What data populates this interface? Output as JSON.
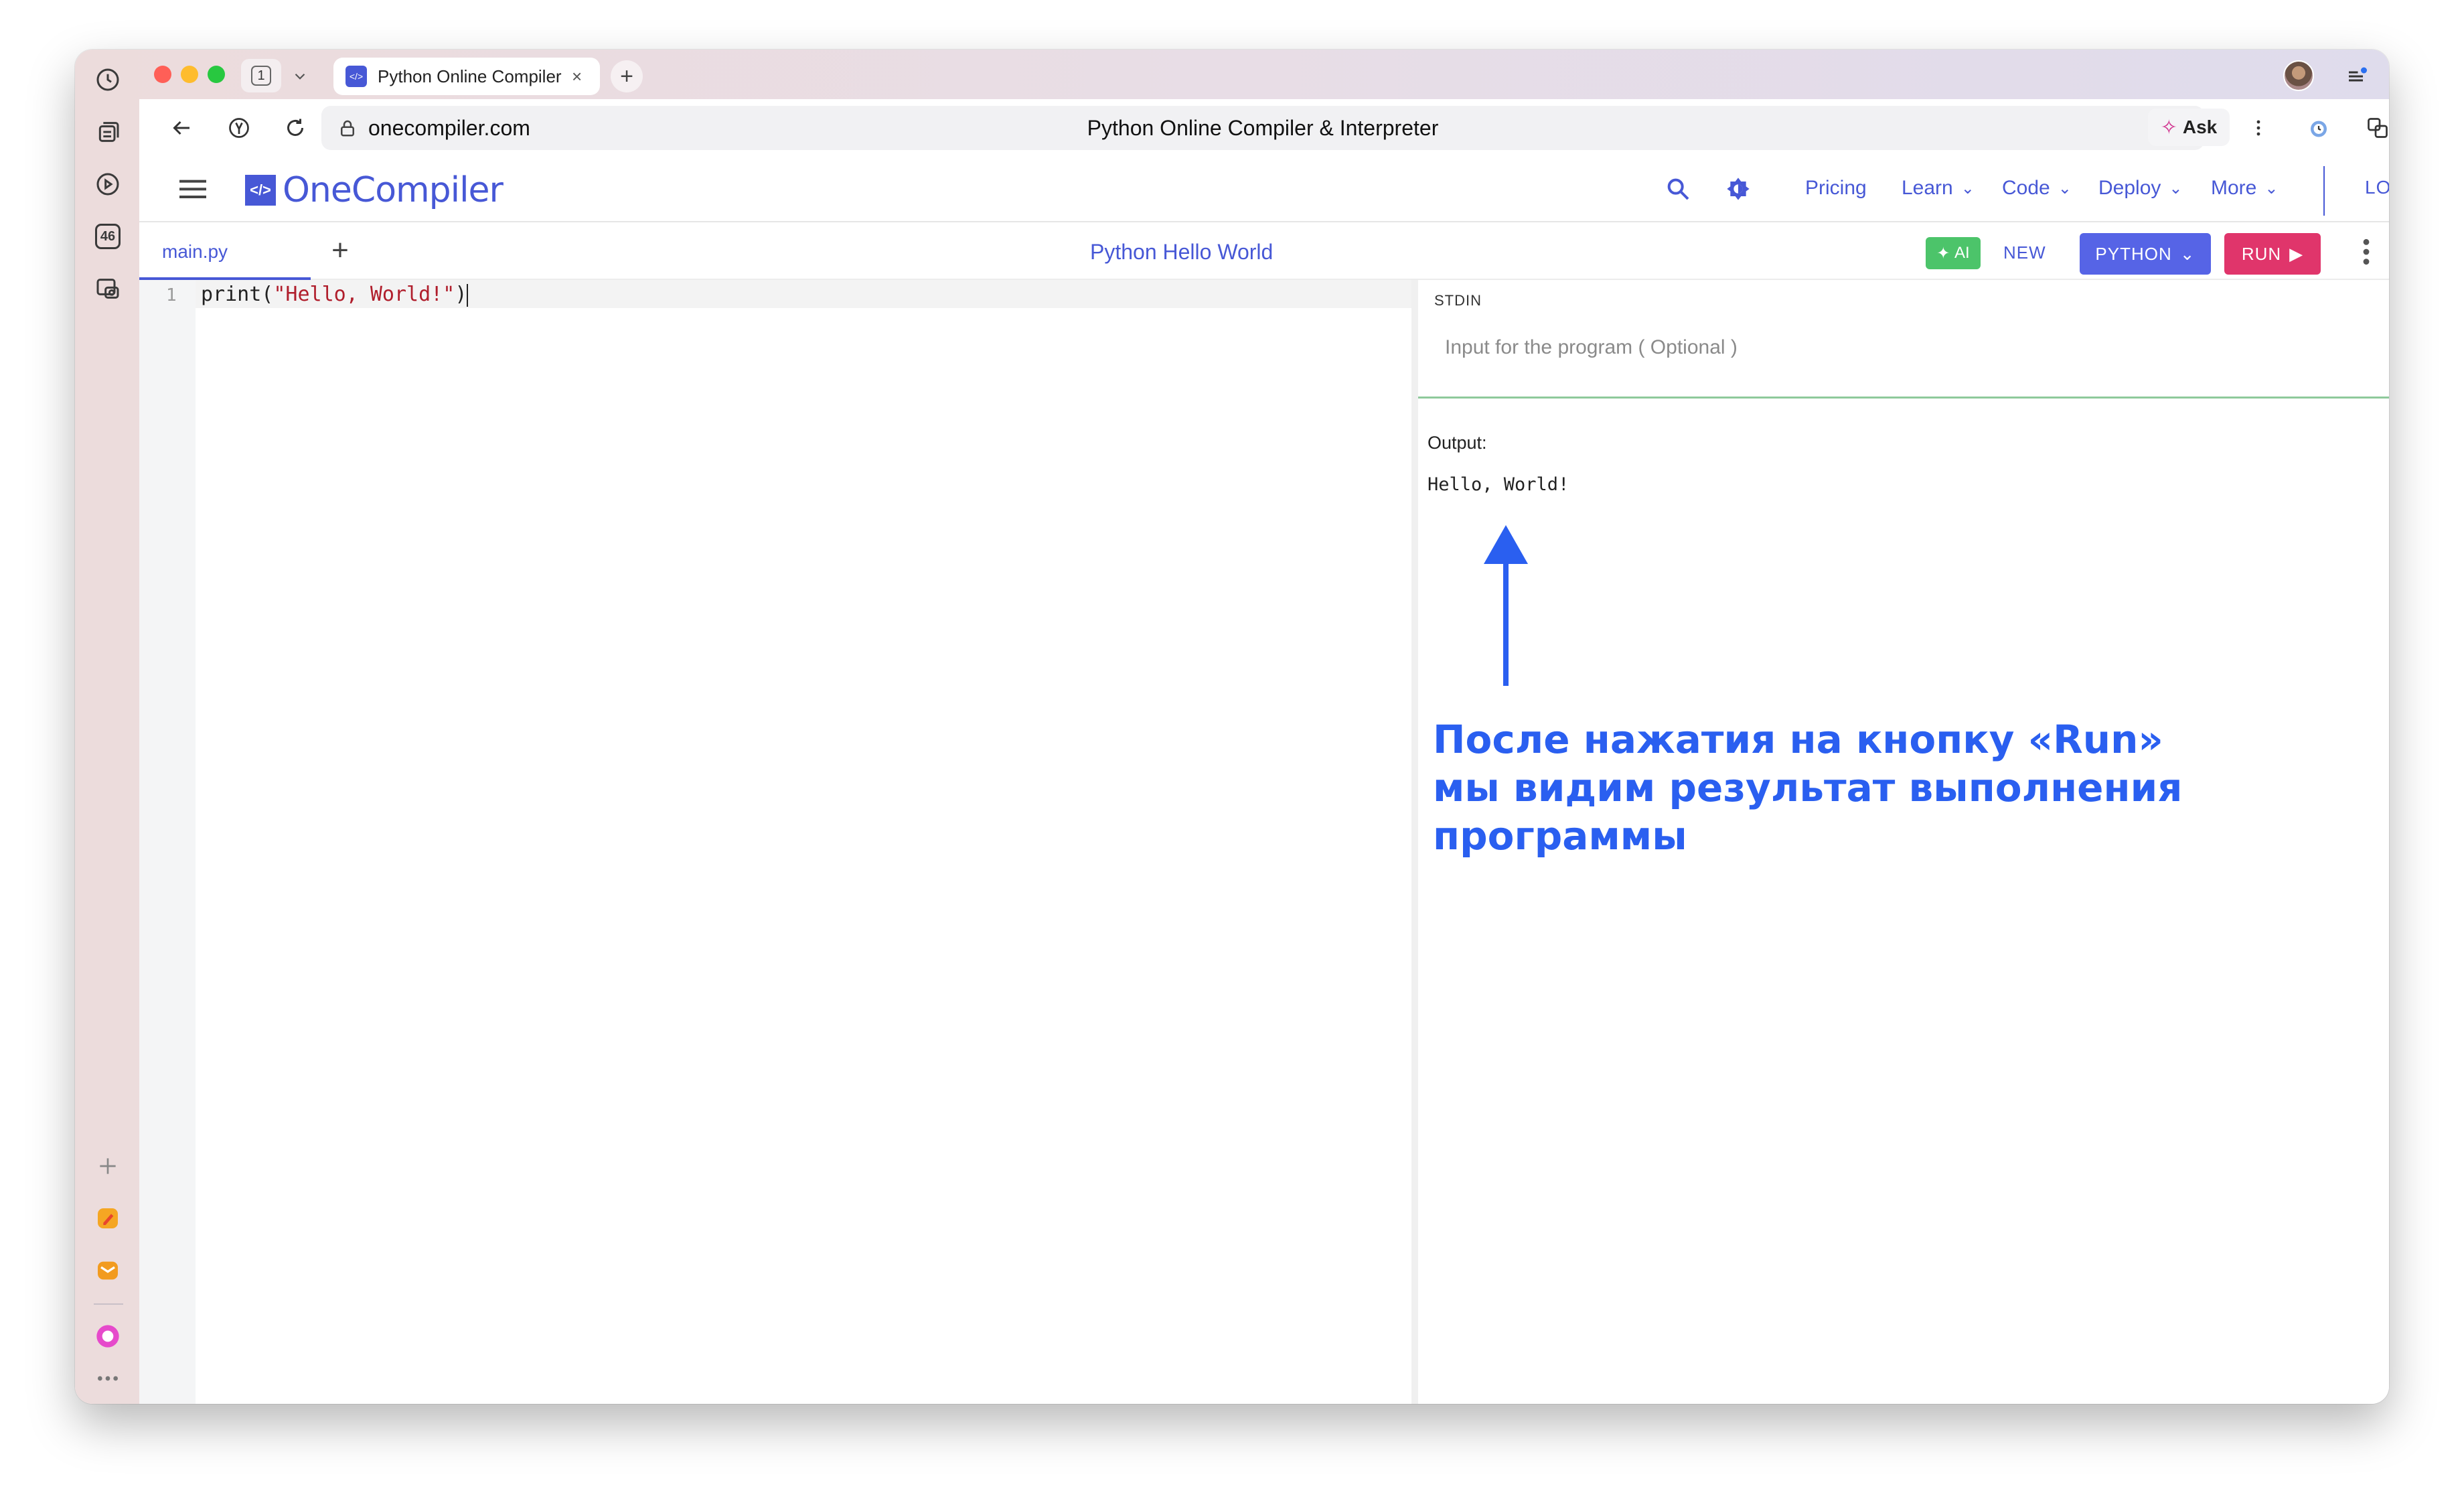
{
  "browser": {
    "tab_count": "1",
    "tab_title": "Python Online Compiler & Interpreter",
    "address_url": "onecompiler.com",
    "page_title": "Python Online Compiler & Interpreter",
    "ask_label": "Ask",
    "sidebar_badge": "46"
  },
  "site": {
    "logo_text": "OneCompiler",
    "nav": [
      {
        "label": "Pricing"
      },
      {
        "label": "Learn"
      },
      {
        "label": "Code"
      },
      {
        "label": "Deploy"
      },
      {
        "label": "More"
      }
    ],
    "login_label": "LOGIN"
  },
  "toolbar": {
    "file_tab": "main.py",
    "program_title": "Python Hello World",
    "ai_label": "AI",
    "new_label": "NEW",
    "language_label": "PYTHON",
    "run_label": "RUN"
  },
  "editor": {
    "line_number": "1",
    "code_fn": "print(",
    "code_str": "\"Hello, World!\"",
    "code_close": ")"
  },
  "io": {
    "stdin_label": "STDIN",
    "stdin_placeholder": "Input for the program ( Optional )",
    "output_label": "Output:",
    "output_text": "Hello, World!"
  },
  "annotation": {
    "line1": "После нажатия на кнопку «Run»",
    "line2": "мы видим результат выполнения",
    "line3": "программы",
    "color": "#2a5ff0"
  },
  "colors": {
    "brand": "#4758d6",
    "run": "#e0356b",
    "language": "#5664e6",
    "ai": "#4cc46a"
  }
}
